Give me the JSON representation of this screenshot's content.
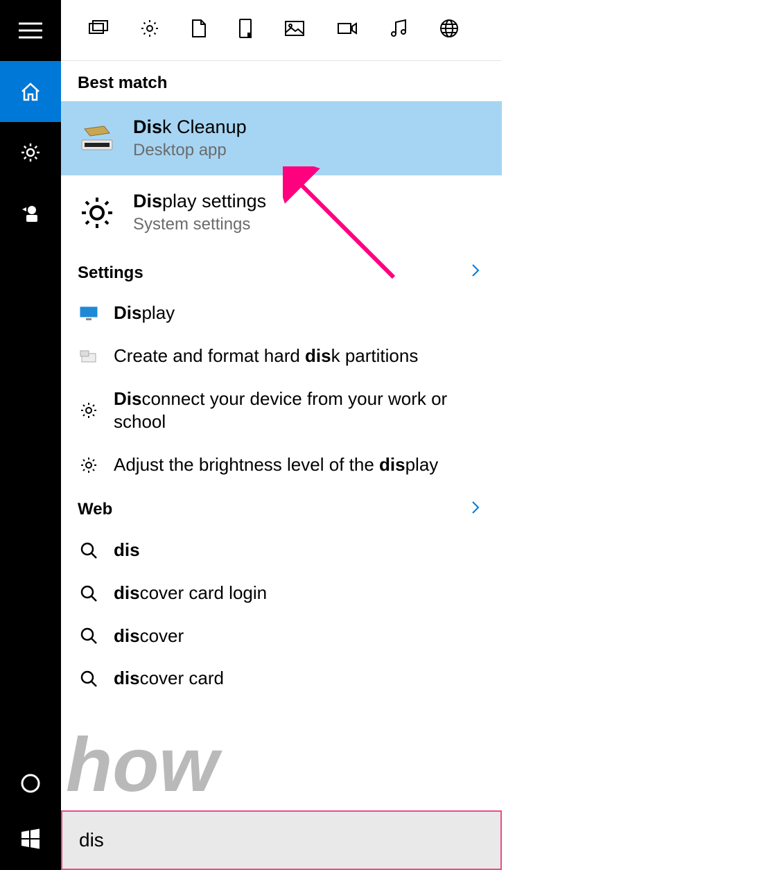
{
  "sidebar": {
    "items": [
      {
        "name": "menu-icon"
      },
      {
        "name": "home-icon",
        "active": true
      },
      {
        "name": "settings-icon"
      },
      {
        "name": "people-icon"
      }
    ],
    "bottom": [
      {
        "name": "cortana-icon"
      },
      {
        "name": "start-icon"
      }
    ]
  },
  "filters": [
    "documents-filter-icon",
    "settings-filter-icon",
    "file-filter-icon",
    "mobile-filter-icon",
    "photo-filter-icon",
    "video-filter-icon",
    "music-filter-icon",
    "web-filter-icon"
  ],
  "sections": {
    "best": "Best match",
    "settings": "Settings",
    "web": "Web"
  },
  "best_match": [
    {
      "title_pre": "Dis",
      "title_post": "k Cleanup",
      "subtitle": "Desktop app",
      "icon": "disk-cleanup-icon",
      "selected": true
    },
    {
      "title_pre": "Dis",
      "title_post": "play settings",
      "subtitle": "System settings",
      "icon": "gear-icon"
    }
  ],
  "settings_list": [
    {
      "pre": "Dis",
      "post": "play",
      "icon": "monitor-icon"
    },
    {
      "plain_before": "Create and format hard ",
      "bold": "dis",
      "plain_after": "k partitions",
      "icon": "partition-icon"
    },
    {
      "pre": "Dis",
      "post": "connect your device from your work or school",
      "icon": "gear-outline-icon"
    },
    {
      "plain_before": "Adjust the brightness level of the ",
      "bold": "dis",
      "plain_after": "play",
      "icon": "gear-outline-icon"
    }
  ],
  "web_list": [
    {
      "pre": "dis",
      "post": ""
    },
    {
      "pre": "dis",
      "post": "cover card login"
    },
    {
      "pre": "dis",
      "post": "cover"
    },
    {
      "pre": "dis",
      "post": "cover card"
    }
  ],
  "search": {
    "value": "dis"
  },
  "watermark": "how"
}
